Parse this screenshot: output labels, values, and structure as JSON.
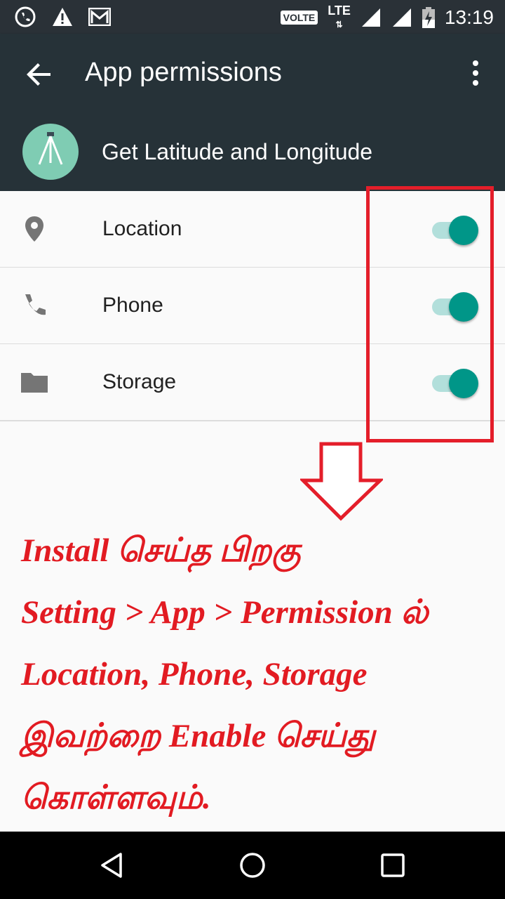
{
  "status_bar": {
    "time": "13:19",
    "volte_label": "VOLTE",
    "network_label": "LTE",
    "left_icons": [
      "whatsapp-call-icon",
      "warning-icon",
      "gmail-icon"
    ],
    "right_icons": [
      "volte-icon",
      "lte-icon",
      "signal-icon",
      "signal-icon",
      "battery-charging-icon"
    ]
  },
  "app_bar": {
    "title": "App permissions"
  },
  "app_header": {
    "app_name": "Get Latitude and Longitude"
  },
  "permissions": [
    {
      "label": "Location",
      "icon": "location-pin-icon",
      "enabled": true
    },
    {
      "label": "Phone",
      "icon": "phone-icon",
      "enabled": true
    },
    {
      "label": "Storage",
      "icon": "folder-icon",
      "enabled": true
    }
  ],
  "annotation": {
    "lines": [
      "Install செய்த பிறகு",
      "Setting > App > Permission ல்",
      "Location, Phone, Storage",
      "இவற்றை Enable செய்து",
      "கொள்ளவும்."
    ],
    "color": "#e21b22"
  },
  "colors": {
    "toolbar": "#263238",
    "accent": "#009688",
    "highlight": "#e41e2a"
  }
}
